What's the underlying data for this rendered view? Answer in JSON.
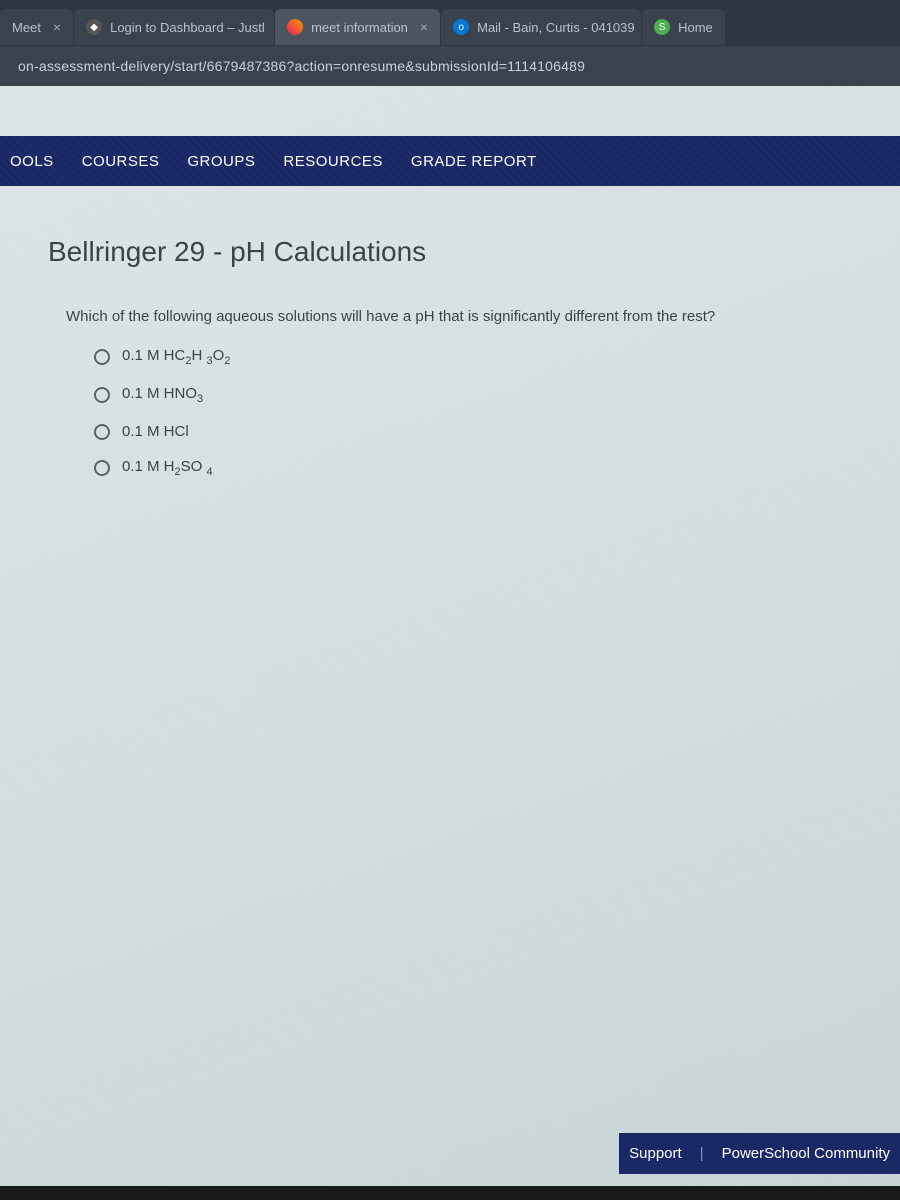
{
  "tabs": [
    {
      "label": "Meet",
      "favicon": "meet"
    },
    {
      "label": "Login to Dashboard – Justl",
      "favicon": "dashboard"
    },
    {
      "label": "meet information",
      "favicon": "colorful"
    },
    {
      "label": "Mail - Bain, Curtis - 041039",
      "favicon": "outlook"
    },
    {
      "label": "Home",
      "favicon": "home"
    }
  ],
  "url": "on-assessment-delivery/start/6679487386?action=onresume&submissionId=1114106489",
  "nav": {
    "items": [
      "OOLS",
      "COURSES",
      "GROUPS",
      "RESOURCES",
      "GRADE REPORT"
    ]
  },
  "page": {
    "title": "Bellringer 29 - pH Calculations",
    "question": "Which of the following aqueous solutions will have a pH that is significantly different from the rest?",
    "options": [
      {
        "prefix": "0.1 M HC",
        "sub1": "2",
        "mid": "H ",
        "sub2": "3",
        "suffix": "O",
        "sub3": "2"
      },
      {
        "prefix": "0.1 M HNO",
        "sub1": "3",
        "mid": "",
        "sub2": "",
        "suffix": "",
        "sub3": ""
      },
      {
        "prefix": "0.1 M HCl",
        "sub1": "",
        "mid": "",
        "sub2": "",
        "suffix": "",
        "sub3": ""
      },
      {
        "prefix": "0.1 M H",
        "sub1": "2",
        "mid": "SO ",
        "sub2": "4",
        "suffix": "",
        "sub3": ""
      }
    ]
  },
  "footer": {
    "support": "Support",
    "community": "PowerSchool Community"
  }
}
